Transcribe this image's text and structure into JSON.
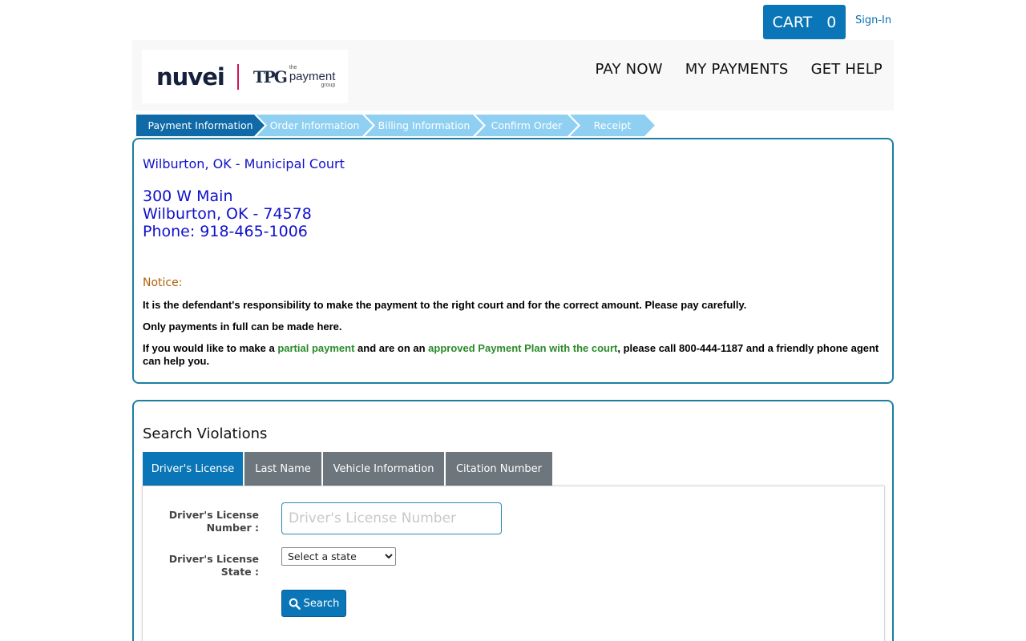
{
  "top": {
    "cart_label": "CART",
    "cart_count": "0",
    "signin": "Sign-In"
  },
  "logo": {
    "brand": "nuvei",
    "tpg_mark": "TPG",
    "tpg_line1": "the",
    "tpg_line2": "payment",
    "tpg_line3": "group"
  },
  "nav": {
    "pay_now": "PAY NOW",
    "my_payments": "MY PAYMENTS",
    "get_help": "GET HELP"
  },
  "steps": [
    {
      "label": "Payment Information",
      "active": true
    },
    {
      "label": "Order Information",
      "active": false
    },
    {
      "label": "Billing Information",
      "active": false
    },
    {
      "label": "Confirm Order",
      "active": false
    },
    {
      "label": "Receipt",
      "active": false
    }
  ],
  "court": {
    "name": "Wilburton, OK - Municipal Court",
    "street": "300 W Main",
    "city_line": "Wilburton, OK - 74578",
    "phone_line": "Phone: 918-465-1006"
  },
  "notice": {
    "label": "Notice:",
    "line1": "It is the defendant's responsibility to make the payment to the right court and for the correct amount. Please pay carefully.",
    "line2": "Only payments in full can be made here.",
    "line3_a": "If you would like to make a ",
    "line3_partial": "partial payment",
    "line3_b": " and are on an ",
    "line3_plan": "approved Payment Plan with the court",
    "line3_c": ", please call 800-444-1187 and a friendly phone agent can help you."
  },
  "search": {
    "title": "Search Violations",
    "tabs": [
      {
        "label": "Driver's License",
        "active": true
      },
      {
        "label": "Last Name",
        "active": false
      },
      {
        "label": "Vehicle Information",
        "active": false
      },
      {
        "label": "Citation Number",
        "active": false
      }
    ],
    "dl_number_label": "Driver's License Number :",
    "dl_number_placeholder": "Driver's License Number",
    "dl_state_label": "Driver's License State :",
    "dl_state_selected": "Select a state",
    "button_label": "Search"
  },
  "colors": {
    "primary": "#0a76b7",
    "panel_border": "#1b7fa0",
    "court_blue": "#1010cc",
    "notice_orange": "#b0620a",
    "green": "#2a8a2a",
    "step_inactive": "#8fd0f2",
    "tab_inactive": "#6d757d"
  },
  "icons": {
    "search_button_icon": "search-icon"
  }
}
